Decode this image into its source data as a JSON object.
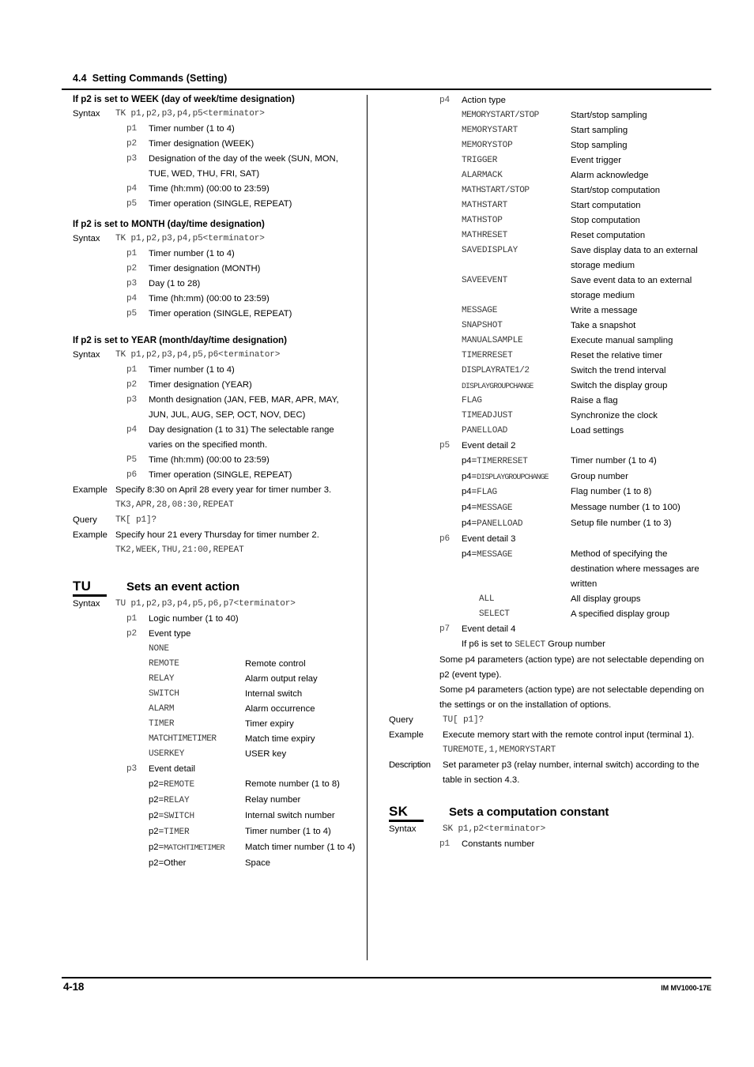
{
  "header": {
    "section_number": "4.4",
    "section_title": "Setting Commands (Setting)"
  },
  "footer": {
    "page_number": "4-18",
    "document_code": "IM MV1000-17E"
  },
  "labels": {
    "syntax": "Syntax",
    "example": "Example",
    "query": "Query",
    "description": "Description"
  },
  "left_column": {
    "week_block": {
      "heading": "If p2 is set to WEEK (day of week/time designation)",
      "syntax": "TK p1,p2,p3,p4,p5<terminator>",
      "params": [
        {
          "key": "p1",
          "desc": "Timer number (1 to 4)"
        },
        {
          "key": "p2",
          "desc": "Timer designation (WEEK)"
        },
        {
          "key": "p3",
          "desc": "Designation of the day of the week (SUN, MON, TUE, WED, THU, FRI, SAT)"
        },
        {
          "key": "p4",
          "desc": "Time (hh:mm) (00:00 to 23:59)"
        },
        {
          "key": "p5",
          "desc": "Timer operation (SINGLE, REPEAT)"
        }
      ]
    },
    "month_block": {
      "heading": "If p2 is set to MONTH (day/time designation)",
      "syntax": "TK p1,p2,p3,p4,p5<terminator>",
      "params": [
        {
          "key": "p1",
          "desc": "Timer number (1 to 4)"
        },
        {
          "key": "p2",
          "desc": "Timer designation (MONTH)"
        },
        {
          "key": "p3",
          "desc": "Day (1 to 28)"
        },
        {
          "key": "p4",
          "desc": "Time (hh:mm) (00:00 to 23:59)"
        },
        {
          "key": "p5",
          "desc": "Timer operation (SINGLE, REPEAT)"
        }
      ]
    },
    "year_block": {
      "heading": "If p2 is set to YEAR (month/day/time designation)",
      "syntax": "TK p1,p2,p3,p4,p5,p6<terminator>",
      "params": [
        {
          "key": "p1",
          "desc": "Timer number (1 to 4)"
        },
        {
          "key": "p2",
          "desc": "Timer designation (YEAR)"
        },
        {
          "key": "p3",
          "desc": "Month designation (JAN, FEB, MAR, APR, MAY, JUN, JUL, AUG, SEP, OCT, NOV, DEC)"
        },
        {
          "key": "p4",
          "desc": "Day designation (1 to 31)  The selectable range varies on the specified month."
        },
        {
          "key": "P5",
          "desc": "Time (hh:mm) (00:00 to 23:59)"
        },
        {
          "key": "p6",
          "desc": "Timer operation (SINGLE, REPEAT)"
        }
      ],
      "example1_text": "Specify 8:30 on April 28 every year for timer number 3.",
      "example1_code": "TK3,APR,28,08:30,REPEAT",
      "query_code": "TK[ p1]?",
      "example2_text": "Specify hour 21 every Thursday for timer number 2.",
      "example2_code": "TK2,WEEK,THU,21:00,REPEAT"
    },
    "tu_command": {
      "code": "TU",
      "title": "Sets an event action",
      "syntax": "TU p1,p2,p3,p4,p5,p6,p7<terminator>",
      "p1": {
        "key": "p1",
        "desc": "Logic number (1 to 40)"
      },
      "p2": {
        "key": "p2",
        "desc": "Event type"
      },
      "event_types": [
        {
          "value": "NONE",
          "meaning": ""
        },
        {
          "value": "REMOTE",
          "meaning": "Remote control"
        },
        {
          "value": "RELAY",
          "meaning": "Alarm output relay"
        },
        {
          "value": "SWITCH",
          "meaning": "Internal switch"
        },
        {
          "value": "ALARM",
          "meaning": "Alarm occurrence"
        },
        {
          "value": "TIMER",
          "meaning": "Timer expiry"
        },
        {
          "value": "MATCHTIMETIMER",
          "meaning": "Match time expiry"
        },
        {
          "value": "USERKEY",
          "meaning": "USER key"
        }
      ],
      "p3": {
        "key": "p3",
        "desc": "Event detail"
      },
      "event_details": [
        {
          "prefix": "p2=",
          "value": "REMOTE",
          "meaning": "Remote number (1 to 8)"
        },
        {
          "prefix": "p2=",
          "value": "RELAY",
          "meaning": "Relay number"
        },
        {
          "prefix": "p2=",
          "value": "SWITCH",
          "meaning": "Internal switch number"
        },
        {
          "prefix": "p2=",
          "value": "TIMER",
          "meaning": "Timer number (1 to 4)"
        },
        {
          "prefix": "p2=",
          "value": "MATCHTIMETIMER",
          "meaning": "Match timer number (1 to 4)"
        },
        {
          "prefix": "p2=",
          "value": "Other",
          "meaning": "Space",
          "plain": true
        }
      ]
    }
  },
  "right_column": {
    "p4": {
      "key": "p4",
      "desc": "Action type"
    },
    "action_types": [
      {
        "value": "MEMORYSTART/STOP",
        "meaning": "Start/stop sampling"
      },
      {
        "value": "MEMORYSTART",
        "meaning": "Start sampling"
      },
      {
        "value": "MEMORYSTOP",
        "meaning": "Stop sampling"
      },
      {
        "value": "TRIGGER",
        "meaning": "Event trigger"
      },
      {
        "value": "ALARMACK",
        "meaning": "Alarm acknowledge"
      },
      {
        "value": "MATHSTART/STOP",
        "meaning": "Start/stop computation"
      },
      {
        "value": "MATHSTART",
        "meaning": "Start computation"
      },
      {
        "value": "MATHSTOP",
        "meaning": "Stop computation"
      },
      {
        "value": "MATHRESET",
        "meaning": "Reset computation"
      },
      {
        "value": "SAVEDISPLAY",
        "meaning": "Save display data to an external storage medium"
      },
      {
        "value": "SAVEEVENT",
        "meaning": "Save event data to an external storage medium"
      },
      {
        "value": "MESSAGE",
        "meaning": "Write a message"
      },
      {
        "value": "SNAPSHOT",
        "meaning": "Take a snapshot"
      },
      {
        "value": "MANUALSAMPLE",
        "meaning": "Execute manual sampling"
      },
      {
        "value": "TIMERRESET",
        "meaning": "Reset the relative timer"
      },
      {
        "value": "DISPLAYRATE1/2",
        "meaning": "Switch the trend interval"
      },
      {
        "value": "DISPLAYGROUPCHANGE",
        "meaning": "Switch the display group"
      },
      {
        "value": "FLAG",
        "meaning": "Raise a flag"
      },
      {
        "value": "TIMEADJUST",
        "meaning": "Synchronize the clock"
      },
      {
        "value": "PANELLOAD",
        "meaning": "Load settings"
      }
    ],
    "p5": {
      "key": "p5",
      "desc": "Event detail 2"
    },
    "event_detail2": [
      {
        "prefix": "p4=",
        "value": "TIMERRESET",
        "meaning": "Timer number (1 to 4)"
      },
      {
        "prefix": "p4=",
        "value": "DISPLAYGROUPCHANGE",
        "meaning": "Group number"
      },
      {
        "prefix": "p4=",
        "value": "FLAG",
        "meaning": "Flag number (1 to 8)"
      },
      {
        "prefix": "p4=",
        "value": "MESSAGE",
        "meaning": "Message number (1 to 100)"
      },
      {
        "prefix": "p4=",
        "value": "PANELLOAD",
        "meaning": "Setup file number (1 to 3)"
      }
    ],
    "p6": {
      "key": "p6",
      "desc": "Event detail 3"
    },
    "event_detail3": [
      {
        "prefix": "p4=",
        "value": "MESSAGE",
        "meaning": "Method of specifying the destination where messages are written"
      }
    ],
    "event_detail3_values": [
      {
        "value": "ALL",
        "meaning": "All display groups"
      },
      {
        "value": "SELECT",
        "meaning": "A specified display group"
      }
    ],
    "p7": {
      "key": "p7",
      "desc": "Event detail 4"
    },
    "p7_line_prefix": "If p6 is set to ",
    "p7_line_mono": "SELECT",
    "p7_line_suffix": "  Group number",
    "notes": [
      "Some p4 parameters (action type) are not selectable depending on p2 (event type).",
      "Some p4 parameters (action type) are not selectable depending on the settings or on the installation of options."
    ],
    "query_code": "TU[ p1]?",
    "example_text": "Execute memory start with the remote control input (terminal 1).",
    "example_code": "TUREMOTE,1,MEMORYSTART",
    "description_text": "Set parameter p3 (relay number, internal switch) according to the table in section 4.3.",
    "sk_command": {
      "code": "SK",
      "title": "Sets a computation constant",
      "syntax": "SK p1,p2<terminator>",
      "p1": {
        "key": "p1",
        "desc": "Constants number"
      }
    }
  }
}
